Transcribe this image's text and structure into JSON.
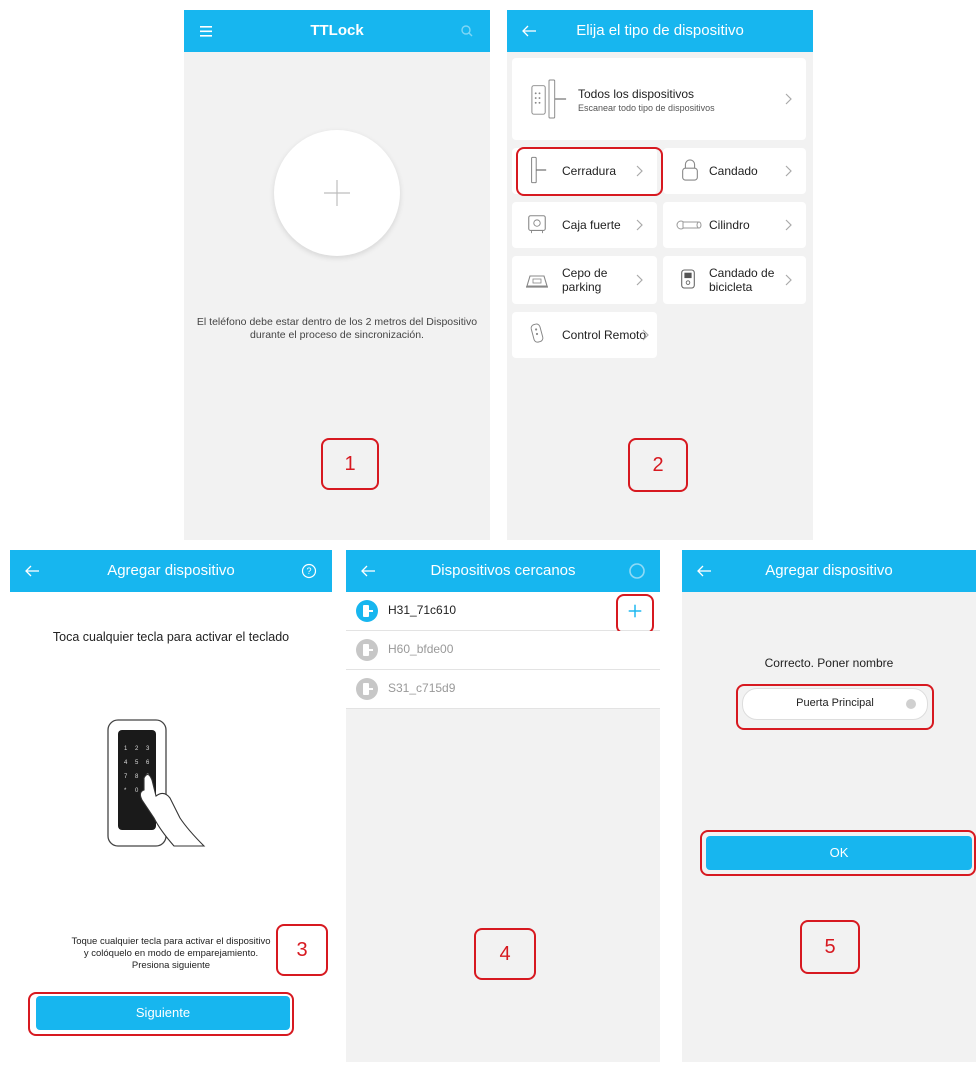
{
  "screen1": {
    "title": "TTLock",
    "instruction_line1": "El teléfono debe estar dentro de los 2 metros del Dispositivo",
    "instruction_line2": "durante el proceso de sincronización.",
    "step": "1",
    "icons": [
      "menu-icon",
      "search-icon",
      "plus-icon"
    ]
  },
  "screen2": {
    "title": "Elija el tipo de dispositivo",
    "all_devices": {
      "label": "Todos los dispositivos",
      "sublabel": "Escanear todo tipo de dispositivos"
    },
    "types": [
      {
        "label": "Cerradura"
      },
      {
        "label": "Candado"
      },
      {
        "label": "Caja fuerte"
      },
      {
        "label": "Cilindro"
      },
      {
        "label": "Cepo de parking"
      },
      {
        "label": "Candado de bicicleta"
      },
      {
        "label": "Control Remoto"
      }
    ],
    "step": "2"
  },
  "screen3": {
    "title": "Agregar dispositivo",
    "heading": "Toca cualquier tecla para activar el teclado",
    "instruction_line1": "Toque cualquier tecla para activar el dispositivo",
    "instruction_line2": "y colóquelo en modo de emparejamiento.",
    "instruction_line3": "Presiona siguiente",
    "button": "Siguiente",
    "step": "3"
  },
  "screen4": {
    "title": "Dispositivos cercanos",
    "devices": [
      {
        "name": "H31_71c610"
      },
      {
        "name": "H60_bfde00"
      },
      {
        "name": "S31_c715d9"
      }
    ],
    "step": "4"
  },
  "screen5": {
    "title": "Agregar dispositivo",
    "message": "Correcto. Poner nombre",
    "name_value": "Puerta Principal",
    "button": "OK",
    "step": "5"
  },
  "colors": {
    "header": "#17b6ef",
    "highlight": "#d71920",
    "background": "#f2f2f2"
  }
}
